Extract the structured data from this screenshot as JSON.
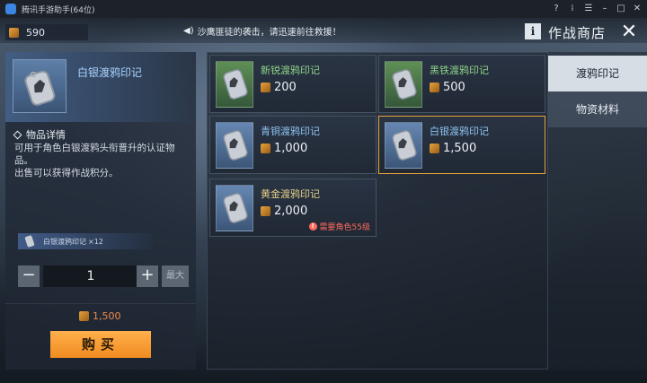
{
  "window": {
    "title": "腾讯手游助手(64位)",
    "controls": [
      "?",
      "⁞",
      "☰",
      "–",
      "□",
      "✕"
    ]
  },
  "topbar": {
    "currency_value": "590",
    "broadcast": "沙鹰匪徒的袭击，请迅速前往救援！",
    "info_label": "i",
    "shop_title": "作战商店",
    "close_glyph": "✕"
  },
  "detail": {
    "item_name": "白银渡鸦印记",
    "section_title": "物品详情",
    "description": "可用于角色白银渡鸦头衔晋升的认证物品。\n出售可以获得作战积分。",
    "owned_label": "白银渡鸦印记",
    "owned_count": "×12",
    "qty_minus": "−",
    "qty_value": "1",
    "qty_plus": "+",
    "max_label": "最大",
    "price": "1,500",
    "buy_label": "购买"
  },
  "items": [
    {
      "name": "新锐渡鸦印记",
      "price": "200",
      "tier": "green",
      "selected": false,
      "requirement": ""
    },
    {
      "name": "黑铁渡鸦印记",
      "price": "500",
      "tier": "green",
      "selected": false,
      "requirement": ""
    },
    {
      "name": "青铜渡鸦印记",
      "price": "1,000",
      "tier": "blue",
      "selected": false,
      "requirement": ""
    },
    {
      "name": "白银渡鸦印记",
      "price": "1,500",
      "tier": "blue",
      "selected": true,
      "requirement": ""
    },
    {
      "name": "黄金渡鸦印记",
      "price": "2,000",
      "tier": "blue",
      "selected": false,
      "requirement": "需要角色55级"
    }
  ],
  "tabs": [
    {
      "label": "渡鸦印记",
      "active": true
    },
    {
      "label": "物资材料",
      "active": false
    }
  ],
  "colors": {
    "accent_orange": "#f08b20",
    "selected_border": "#e6a23a",
    "requirement_red": "#ff6a5c"
  }
}
